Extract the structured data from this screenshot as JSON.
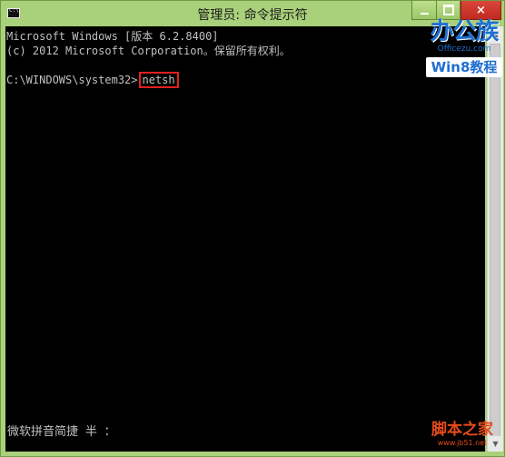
{
  "window": {
    "title": "管理员: 命令提示符",
    "controls": {
      "minimize": "minimize",
      "maximize": "maximize",
      "close": "×"
    }
  },
  "console": {
    "lines": [
      "Microsoft Windows [版本 6.2.8400]",
      "(c) 2012 Microsoft Corporation。保留所有权利。",
      ""
    ],
    "prompt": "C:\\WINDOWS\\system32>",
    "command": "netsh"
  },
  "ime_status": "微软拼音简捷 半 ：",
  "watermarks": {
    "top_brand": "办公族",
    "top_domain": "Officezu.com",
    "top_badge": "Win8教程",
    "bottom_brand": "脚本之家",
    "bottom_domain": "www.jb51.net"
  },
  "colors": {
    "title_bar": "#a9d07a",
    "console_bg": "#000000",
    "console_text": "#c0c0c0",
    "highlight_border": "#e02020",
    "close_button": "#c22a1f"
  }
}
